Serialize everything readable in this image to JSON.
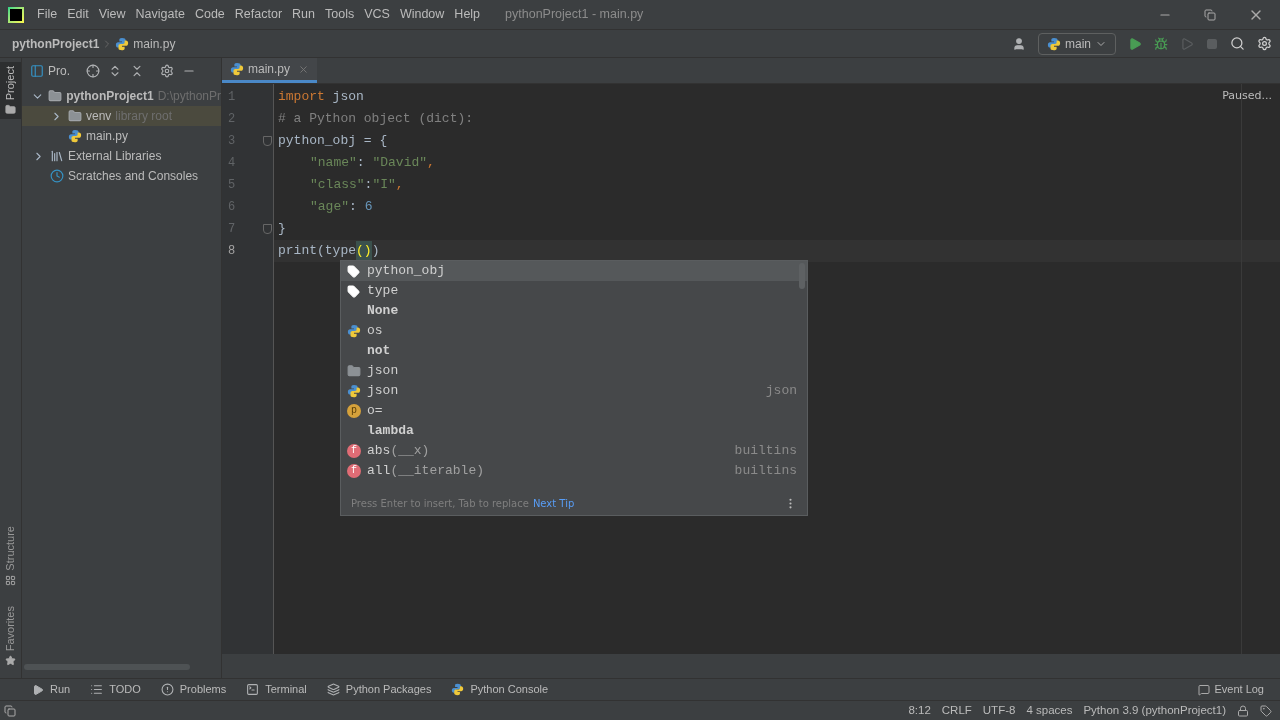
{
  "menu": [
    "File",
    "Edit",
    "View",
    "Navigate",
    "Code",
    "Refactor",
    "Run",
    "Tools",
    "VCS",
    "Window",
    "Help"
  ],
  "window_title": "pythonProject1 - main.py",
  "breadcrumb": [
    "pythonProject1",
    "main.py"
  ],
  "run_config": "main",
  "left_strip": {
    "top": [
      {
        "label": "Project",
        "selected": true
      }
    ],
    "bottom": [
      {
        "label": "Structure",
        "selected": false
      },
      {
        "label": "Favorites",
        "selected": false
      }
    ]
  },
  "project_panel": {
    "title": "Pro.",
    "tree": [
      {
        "label": "pythonProject1",
        "hint": "D:\\pythonPr",
        "kind": "folder",
        "expanded": true,
        "selected": false,
        "children": [
          {
            "label": "venv",
            "hint": "library root",
            "kind": "folder",
            "expanded": false,
            "selected": true
          },
          {
            "label": "main.py",
            "kind": "python"
          }
        ]
      },
      {
        "label": "External Libraries",
        "kind": "library",
        "expanded": false,
        "selected": false
      },
      {
        "label": "Scratches and Consoles",
        "kind": "scratch"
      }
    ]
  },
  "editor": {
    "tab": "main.py",
    "status": "Paused...",
    "lines": [
      {
        "number": "1",
        "current": false,
        "indented": false,
        "fold": false,
        "tokens": [
          {
            "text": "import",
            "kind": "keyword"
          },
          {
            "text": " json",
            "kind": "plain"
          }
        ]
      },
      {
        "number": "2",
        "current": false,
        "indented": false,
        "fold": false,
        "tokens": [
          {
            "text": "# a Python object (dict):",
            "kind": "comment"
          }
        ]
      },
      {
        "number": "3",
        "current": false,
        "indented": false,
        "fold": true,
        "tokens": [
          {
            "text": "python_obj = {",
            "kind": "plain"
          }
        ]
      },
      {
        "number": "4",
        "current": false,
        "indented": true,
        "fold": false,
        "tokens": [
          {
            "text": "\"name\"",
            "kind": "string"
          },
          {
            "text": ": ",
            "kind": "plain"
          },
          {
            "text": "\"David\"",
            "kind": "string"
          },
          {
            "text": ",",
            "kind": "keyword"
          }
        ]
      },
      {
        "number": "5",
        "current": false,
        "indented": true,
        "fold": false,
        "tokens": [
          {
            "text": "\"class\"",
            "kind": "string"
          },
          {
            "text": ":",
            "kind": "plain"
          },
          {
            "text": "\"I\"",
            "kind": "string"
          },
          {
            "text": ",",
            "kind": "keyword"
          }
        ]
      },
      {
        "number": "6",
        "current": false,
        "indented": true,
        "fold": false,
        "tokens": [
          {
            "text": "\"age\"",
            "kind": "string"
          },
          {
            "text": ": ",
            "kind": "plain"
          },
          {
            "text": "6",
            "kind": "number"
          }
        ]
      },
      {
        "number": "7",
        "current": false,
        "indented": false,
        "fold": true,
        "tokens": [
          {
            "text": "}",
            "kind": "plain"
          }
        ]
      },
      {
        "number": "8",
        "current": true,
        "indented": false,
        "fold": false,
        "tokens": [
          {
            "text": "print(type",
            "kind": "plain"
          },
          {
            "text": "()",
            "kind": "match"
          },
          {
            "text": ")",
            "kind": "plain"
          }
        ]
      }
    ]
  },
  "completion": {
    "items": [
      {
        "label": "python_obj",
        "kind": "variable",
        "bold": false,
        "selected": true
      },
      {
        "label": "type",
        "kind": "variable",
        "bold": false,
        "selected": false
      },
      {
        "label": "None",
        "kind": "keyword",
        "bold": true,
        "selected": false
      },
      {
        "label": "os",
        "kind": "module",
        "bold": false,
        "selected": false
      },
      {
        "label": "not",
        "kind": "keyword",
        "bold": true,
        "selected": false
      },
      {
        "label": "json",
        "kind": "package",
        "bold": false,
        "selected": false
      },
      {
        "label": "json",
        "kind": "module",
        "bold": false,
        "selected": false,
        "source": "json"
      },
      {
        "label": "o=",
        "kind": "parameter",
        "badge": "p",
        "bold": false,
        "selected": false
      },
      {
        "label": "lambda",
        "kind": "keyword",
        "bold": true,
        "selected": false
      },
      {
        "label": "abs",
        "args": "(__x)",
        "kind": "function",
        "badge": "f",
        "bold": false,
        "selected": false,
        "source": "builtins"
      },
      {
        "label": "all",
        "args": "(__iterable)",
        "kind": "function",
        "badge": "f",
        "bold": false,
        "selected": false,
        "source": "builtins"
      }
    ],
    "hint": "Press Enter to insert, Tab to replace",
    "link": "Next Tip"
  },
  "tool_tabs": [
    {
      "label": "Run",
      "kind": "run"
    },
    {
      "label": "TODO",
      "kind": "list"
    },
    {
      "label": "Problems",
      "kind": "alert"
    },
    {
      "label": "Terminal",
      "kind": "terminal"
    },
    {
      "label": "Python Packages",
      "kind": "layers"
    },
    {
      "label": "Python Console",
      "kind": "python"
    }
  ],
  "event_log": "Event Log",
  "status_bar": [
    "8:12",
    "CRLF",
    "UTF-8",
    "4 spaces",
    "Python 3.9 (pythonProject1)"
  ]
}
